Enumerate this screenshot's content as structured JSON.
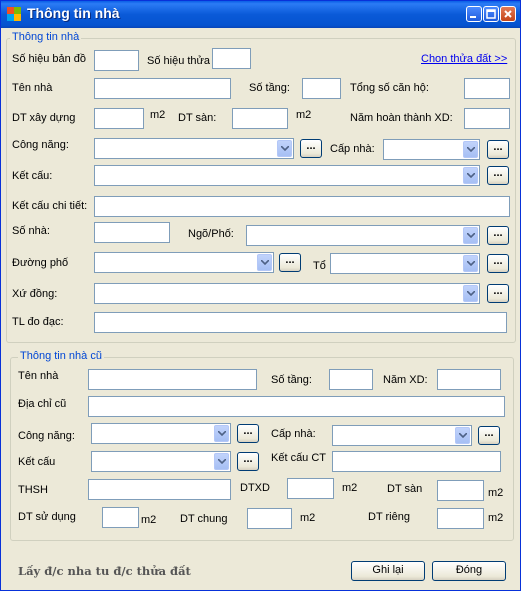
{
  "window": {
    "title": "Thông tin nhà"
  },
  "group1": {
    "title": "Thông tin nhà",
    "so_hieu_ban_do": "Số hiệu bản đồ",
    "so_hieu_thua": "Số hiệu thửa",
    "chon_thua_dat": "Chon thửa đất >>",
    "ten_nha": "Tên nhà",
    "so_tang": "Số tầng:",
    "tong_so_can_ho": "Tổng số căn hộ:",
    "dt_xay_dung": "DT xây dựng",
    "m2": "m2",
    "dt_san": "DT sàn:",
    "nam_hoan_thanh": "Năm hoàn thành XD:",
    "cong_nang": "Công năng:",
    "cap_nha": "Cấp nhà:",
    "ket_cau": "Kết cấu:",
    "ket_cau_chi_tiet": "Kết cấu chi tiết:",
    "so_nha": "Số nhà:",
    "ngo_pho": "Ngõ/Phố:",
    "duong_pho": "Đường phố",
    "to": "Tổ",
    "xu_dong": "Xứ đồng:",
    "tl_do_dac": "TL đo đạc:"
  },
  "group2": {
    "title": "Thông tin nhà cũ",
    "ten_nha": "Tên nhà",
    "so_tang": "Số tầng:",
    "nam_xd": "Năm XD:",
    "dia_chi_cu": "Địa chỉ cũ",
    "cong_nang": "Công năng:",
    "cap_nha": "Cấp nhà:",
    "ket_cau": "Kết cấu",
    "ket_cau_ct": "Kết cấu CT",
    "thsh": "THSH",
    "dtxd": "DTXD",
    "dt_san": "DT sàn",
    "dt_su_dung": "DT sử dụng",
    "dt_chung": "DT chung",
    "dt_rieng": "DT riêng",
    "m2": "m2"
  },
  "footer": {
    "status": "Lấy đ/c nha tu đ/c thửa đất",
    "save_label": "Ghi lại",
    "close_label": "Đóng"
  },
  "dots": "..."
}
